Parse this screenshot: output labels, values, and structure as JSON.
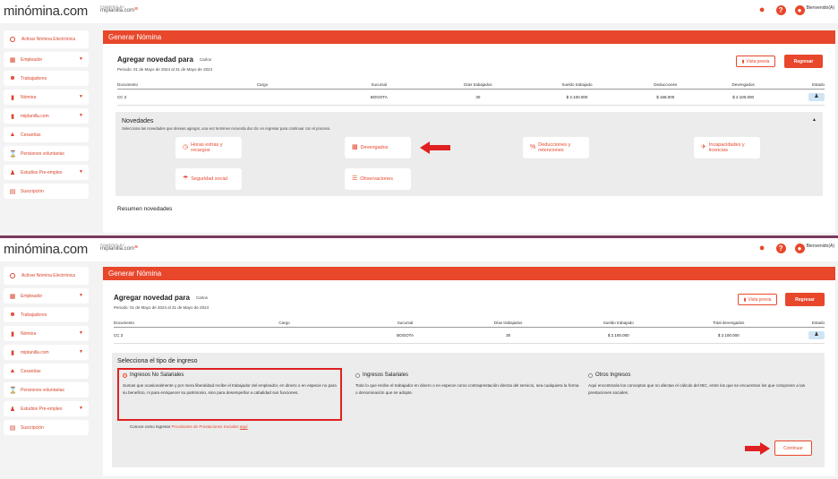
{
  "brand": {
    "logo": "minómina.com",
    "powered_by": "POWERED BY",
    "powered_name": "miplanilla.com",
    "welcome": "Bienvenido(A)"
  },
  "sidebar": {
    "items": [
      {
        "label": "Activar Nómina Electrónica",
        "icon": "circle-icon",
        "caret": false
      },
      {
        "label": "Empleador",
        "icon": "building-icon",
        "caret": true
      },
      {
        "label": "Trabajadores",
        "icon": "users-icon",
        "caret": false
      },
      {
        "label": "Nómina",
        "icon": "document-icon",
        "caret": true
      },
      {
        "label": "miplanilla.com",
        "icon": "document-icon",
        "caret": true
      },
      {
        "label": "Cesantías",
        "icon": "piggy-bank-icon",
        "caret": false
      },
      {
        "label": "Pensiones voluntarias",
        "icon": "hourglass-icon",
        "caret": false
      },
      {
        "label": "Estudios Pre-empleo",
        "icon": "user-check-icon",
        "caret": true
      },
      {
        "label": "Suscripción",
        "icon": "card-icon",
        "caret": false
      }
    ]
  },
  "screen1": {
    "panel_title": "Generar Nómina",
    "heading": "Agregar novedad para",
    "employee": "Carlos",
    "period": "Periodo: 01 de Mayo de 2024 al 31 de Mayo de 2024",
    "vista_previa": "Vista previa",
    "regresar": "Regresar",
    "columns": [
      "Documento",
      "Cargo",
      "Sucursal",
      "Días trabajados",
      "Sueldo trabajado",
      "Deducciones",
      "Devengados",
      "Estado"
    ],
    "row": {
      "documento": "CC 2",
      "cargo": "",
      "sucursal": "BOGOTA",
      "dias": "30",
      "sueldo": "$ 2.100.000",
      "deducciones": "$ 168.000",
      "devengados": "$ 2.100.000"
    },
    "novedades": {
      "title": "Novedades",
      "subtitle": "Selecciona las novedades que deseas agregar, una vez termines recuerda dar clic en regresar para continuar con el proceso.",
      "buttons": {
        "horas": "Horas extras y recargos",
        "devengados": "Devengados",
        "deducciones": "Deducciones y retenciones",
        "incapacidades": "Incapacidades y licencias",
        "seguridad": "Seguridad social",
        "observaciones": "Observaciones"
      }
    },
    "resumen": "Resumen novedades"
  },
  "screen2": {
    "panel_title": "Generar Nómina",
    "heading": "Agregar novedad para",
    "employee": "Carlos",
    "period": "Periodo: 01 de Mayo de 2024 al 31 de Mayo de 2024",
    "vista_previa": "Vista previa",
    "regresar": "Regresar",
    "columns": [
      "Documento",
      "Cargo",
      "Sucursal",
      "Días trabajados",
      "Sueldo trabajado",
      "Total devengados",
      "Estado"
    ],
    "row": {
      "documento": "CC 2",
      "cargo": "",
      "sucursal": "BOGOTA",
      "dias": "30",
      "sueldo": "$ 2.100.000",
      "total": "$ 2.100.000"
    },
    "tipo_title": "Selecciona el tipo de ingreso",
    "options": {
      "no_salariales": {
        "name": "Ingresos No Salariales",
        "desc": "Sumas que ocasionalmente y por mera liberalidad recibe el trabajador del empleador, en dinero o en especie no para su beneficio, ni para enriquecer su patrimonio, sino para desempeñar a cabalidad sus funciones."
      },
      "salariales": {
        "name": "Ingresos Salariales",
        "desc": "Todo lo que recibe el trabajador en dinero o en especie como contraprestación directa del servicio, sea cualquiera la forma o denominación que se adopte."
      },
      "otros": {
        "name": "Otros Ingresos",
        "desc": "Aquí encontrarás los conceptos que no afectan el cálculo del IBC, entre los que se encuentran los que componen a las prestaciones sociales."
      }
    },
    "conoce_text": "Conoce como ingresar",
    "conoce_link": "Provisiones de Prestaciones Sociales",
    "conoce_aqui": "aquí",
    "continuar": "Continuar"
  },
  "colors": {
    "accent": "#e8472b",
    "highlight": "#e02020",
    "divider": "#7b3a5e"
  }
}
